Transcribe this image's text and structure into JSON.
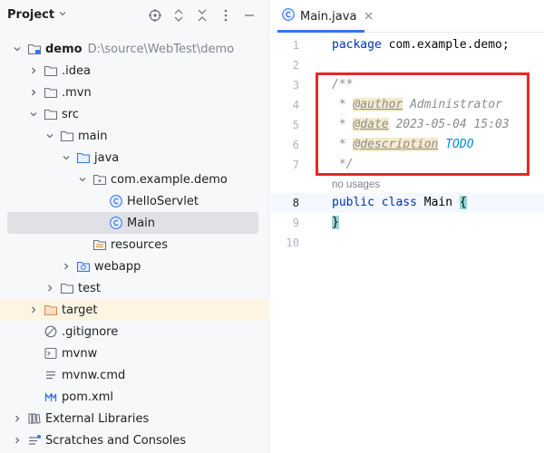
{
  "project_panel": {
    "title": "Project",
    "tree": [
      {
        "label": "demo",
        "path": "D:\\source\\WebTest\\demo",
        "bold": true
      },
      {
        "label": ".idea"
      },
      {
        "label": ".mvn"
      },
      {
        "label": "src"
      },
      {
        "label": "main"
      },
      {
        "label": "java"
      },
      {
        "label": "com.example.demo"
      },
      {
        "label": "HelloServlet"
      },
      {
        "label": "Main",
        "selected": true
      },
      {
        "label": "resources"
      },
      {
        "label": "webapp"
      },
      {
        "label": "test"
      },
      {
        "label": "target"
      },
      {
        "label": ".gitignore"
      },
      {
        "label": "mvnw"
      },
      {
        "label": "mvnw.cmd"
      },
      {
        "label": "pom.xml"
      },
      {
        "label": "External Libraries"
      },
      {
        "label": "Scratches and Consoles"
      }
    ]
  },
  "editor": {
    "tab_label": "Main.java",
    "line_numbers": [
      "1",
      "2",
      "3",
      "4",
      "5",
      "6",
      "7",
      "8",
      "9",
      "10"
    ],
    "code": {
      "l1_kw": "package",
      "l1_rest": " com.example.demo;",
      "l3": "/**",
      "l4_prefix": " * ",
      "l4_tag": "@author",
      "l4_rest": " Administrator",
      "l5_prefix": " * ",
      "l5_tag": "@date",
      "l5_rest": " 2023-05-04 15:03",
      "l6_prefix": " * ",
      "l6_tag": "@description",
      "l6_todo": "TODO",
      "l7": " */",
      "hint": "no usages",
      "l8_kw1": "public",
      "l8_kw2": "class",
      "l8_name": "Main",
      "l8_brace": "{",
      "l9_brace": "}"
    }
  },
  "colors": {
    "accent": "#3574f0",
    "selection": "#dfe1e5",
    "highlight_box": "#e5282b",
    "keyword": "#0033b3",
    "comment": "#8c8c8c"
  }
}
